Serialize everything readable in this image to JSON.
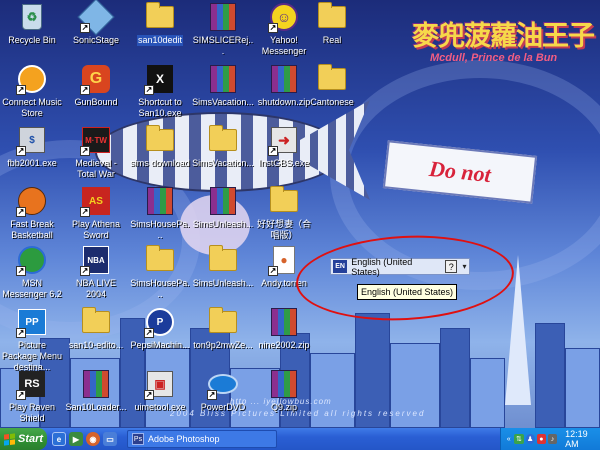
{
  "wallpaper": {
    "logo_title": "麥兜菠蘿油王子",
    "logo_subtitle": "Mcdull, Prince de la Bun",
    "banner_text": "Do not",
    "credit_line1": "http ... iyellowbus.com",
    "credit_line2": "2004 Bliss Pictures Limited all rights reserved"
  },
  "desktop_icons": [
    {
      "label": "Recycle Bin",
      "icon": "recycle-bin-icon"
    },
    {
      "label": "SonicStage",
      "icon": "sonicstage-icon"
    },
    {
      "label": "san10dedit",
      "icon": "folder-icon"
    },
    {
      "label": "SIMSLICERej...",
      "icon": "winrar-icon"
    },
    {
      "label": "Yahoo! Messenger",
      "icon": "yahoo-messenger-icon"
    },
    {
      "label": "Real",
      "icon": "folder-icon"
    },
    {
      "label": "Connect Music Store",
      "icon": "connect-music-icon"
    },
    {
      "label": "GunBound",
      "icon": "gunbound-icon"
    },
    {
      "label": "Shortcut to San10.exe",
      "icon": "san10-icon"
    },
    {
      "label": "SimsVacation...",
      "icon": "winrar-icon"
    },
    {
      "label": "shutdown.zip",
      "icon": "winrar-icon"
    },
    {
      "label": "Cantonese",
      "icon": "folder-icon"
    },
    {
      "label": "fbb2001.exe",
      "icon": "fbb2001-icon"
    },
    {
      "label": "Medieval - Total War",
      "icon": "medieval-total-war-icon"
    },
    {
      "label": "sims download",
      "icon": "folder-icon"
    },
    {
      "label": "SimsVacation...",
      "icon": "folder-icon"
    },
    {
      "label": "InstGBS.exe",
      "icon": "installer-icon"
    },
    {
      "label": "Fast Break Basketball",
      "icon": "basketball-icon"
    },
    {
      "label": "Play Athena Sword",
      "icon": "athena-sword-icon"
    },
    {
      "label": "SimsHousePa...",
      "icon": "winrar-icon"
    },
    {
      "label": "SimsUnleash...",
      "icon": "winrar-icon"
    },
    {
      "label": "好好想妻（合唱版）",
      "icon": "folder-icon"
    },
    {
      "label": "MSN Messenger 6.2",
      "icon": "msn-messenger-icon"
    },
    {
      "label": "NBA LIVE 2004",
      "icon": "nba-live-icon"
    },
    {
      "label": "SimsHousePa...",
      "icon": "folder-icon"
    },
    {
      "label": "SimsUnleash...",
      "icon": "folder-icon"
    },
    {
      "label": "Andy.torren",
      "icon": "torrent-file-icon"
    },
    {
      "label": "Picture Package Menu destina...",
      "icon": "picture-package-icon"
    },
    {
      "label": "san10-edito...",
      "icon": "folder-icon"
    },
    {
      "label": "PepsiMachin...",
      "icon": "pepsi-machine-icon"
    },
    {
      "label": "ton9p2mwZe...",
      "icon": "folder-icon"
    },
    {
      "label": "nine2002.zip",
      "icon": "winrar-icon"
    },
    {
      "label": "Play Raven Shield",
      "icon": "raven-shield-icon"
    },
    {
      "label": "San10Loader...",
      "icon": "winrar-icon"
    },
    {
      "label": "uimetool.exe",
      "icon": "uimetool-icon"
    },
    {
      "label": "PowerDVD",
      "icon": "powerdvd-icon"
    },
    {
      "label": "Q9.zip",
      "icon": "winrar-icon"
    }
  ],
  "language_bar": {
    "code": "EN",
    "name": "English (United States)",
    "help": "?",
    "options": "▾",
    "tooltip": "English (United States)"
  },
  "taskbar": {
    "start_label": "Start",
    "task_label": "Adobe Photoshop",
    "tray_expand": "«",
    "clock": "12:19 AM"
  },
  "colors": {
    "taskbar": "#2a5fd4",
    "start": "#2f8e33",
    "annotation": "#e01010"
  }
}
